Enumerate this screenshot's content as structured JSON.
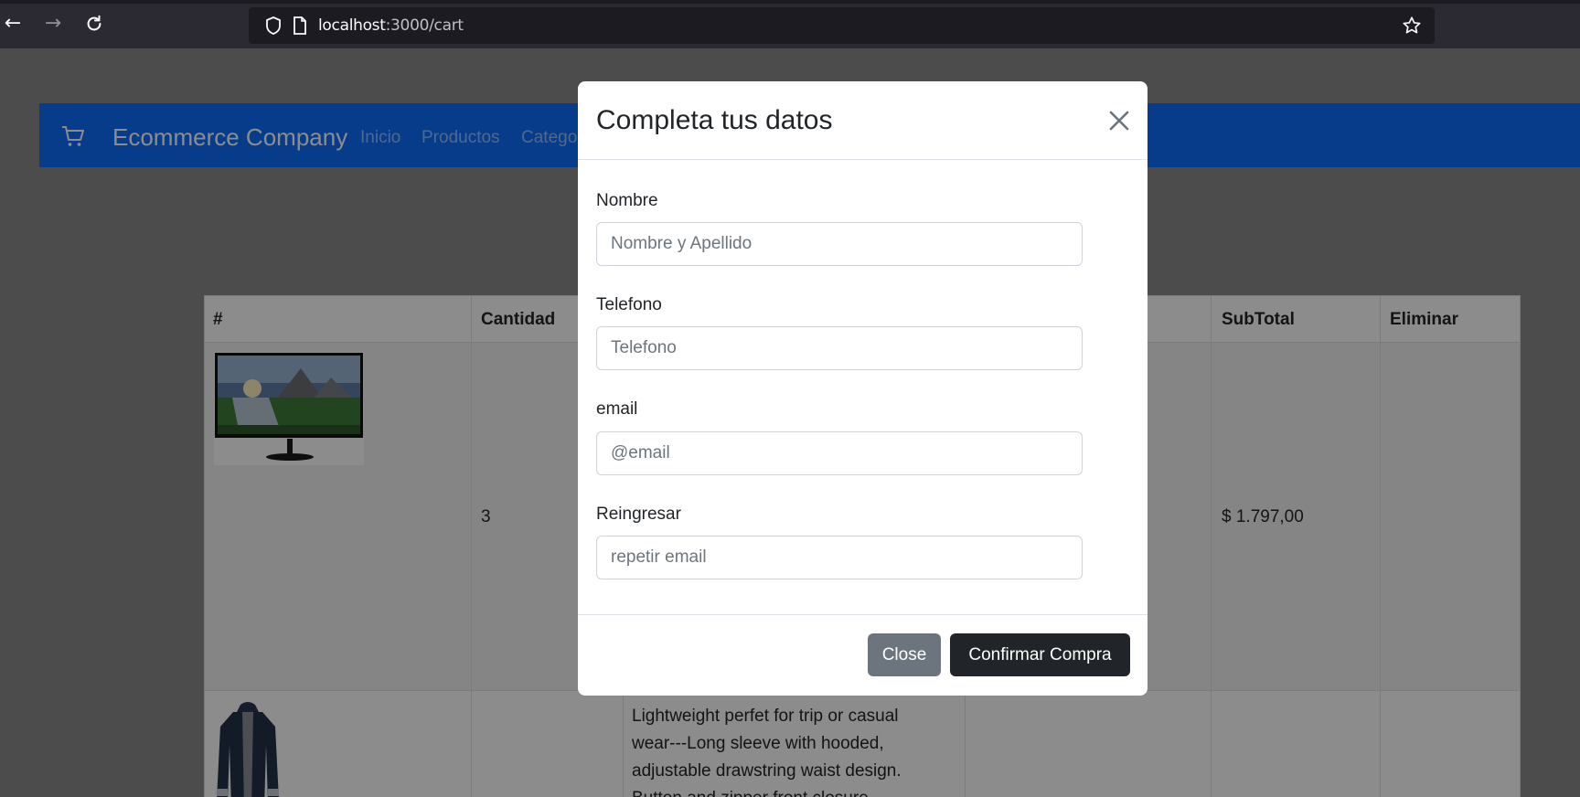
{
  "browser": {
    "url_host": "localhost",
    "url_path": ":3000/cart",
    "back_icon": "arrow-left-icon",
    "forward_icon": "arrow-right-icon",
    "reload_icon": "reload-icon"
  },
  "navbar": {
    "brand": "Ecommerce Company",
    "links": [
      "Inicio",
      "Productos",
      "Catego"
    ],
    "color": "#0d6efd"
  },
  "table": {
    "headers": [
      "#",
      "Cantidad",
      "SubTotal",
      "Eliminar"
    ],
    "rows": [
      {
        "image": "monitor-image",
        "cantidad": "3",
        "subtotal": "$ 1.797,00"
      },
      {
        "image": "coat-image",
        "description": "Lightweight perfet for trip or casual wear---Long sleeve with hooded, adjustable drawstring waist design. Button and zipper front closure"
      }
    ]
  },
  "modal": {
    "title": "Completa tus datos",
    "fields": [
      {
        "label": "Nombre",
        "placeholder": "Nombre y Apellido",
        "value": ""
      },
      {
        "label": "Telefono",
        "placeholder": "Telefono",
        "value": ""
      },
      {
        "label": "email",
        "placeholder": "@email",
        "value": ""
      },
      {
        "label": "Reingresar",
        "placeholder": "repetir email",
        "value": ""
      }
    ],
    "close_label": "Close",
    "confirm_label": "Confirmar Compra"
  }
}
